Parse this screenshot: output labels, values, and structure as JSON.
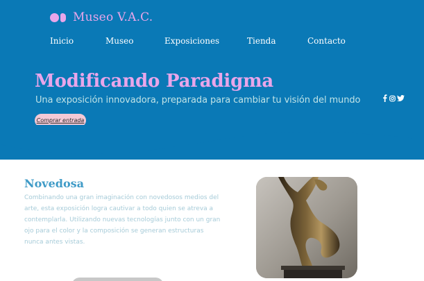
{
  "brand": {
    "name": "Museo V.A.C.",
    "color": "#e9a6ea"
  },
  "nav": {
    "items": [
      {
        "label": "Inicio"
      },
      {
        "label": "Museo"
      },
      {
        "label": "Exposiciones"
      },
      {
        "label": "Tienda"
      },
      {
        "label": "Contacto"
      }
    ]
  },
  "hero": {
    "title": "Modificando Paradigma",
    "subtitle": "Una exposición innovadora, preparada para cambiar tu visión del mundo",
    "cta_label": "Comprar entrada",
    "background_color": "#0a79b6",
    "title_color": "#e9a6ea",
    "cta_color": "#f3c9d6"
  },
  "social": [
    "facebook-icon",
    "instagram-icon",
    "twitter-icon"
  ],
  "section": {
    "title": "Novedosa",
    "body": "Combinando una gran imaginación con novedosos medios del arte, esta exposición logra cautivar a todo quien se atreva a contemplarla. Utilizando nuevas tecnologías junto con un gran ojo para el color y la composición se generan estructuras nunca antes vistas.",
    "title_color": "#3f9bc7",
    "body_color": "#a6cbd8"
  }
}
